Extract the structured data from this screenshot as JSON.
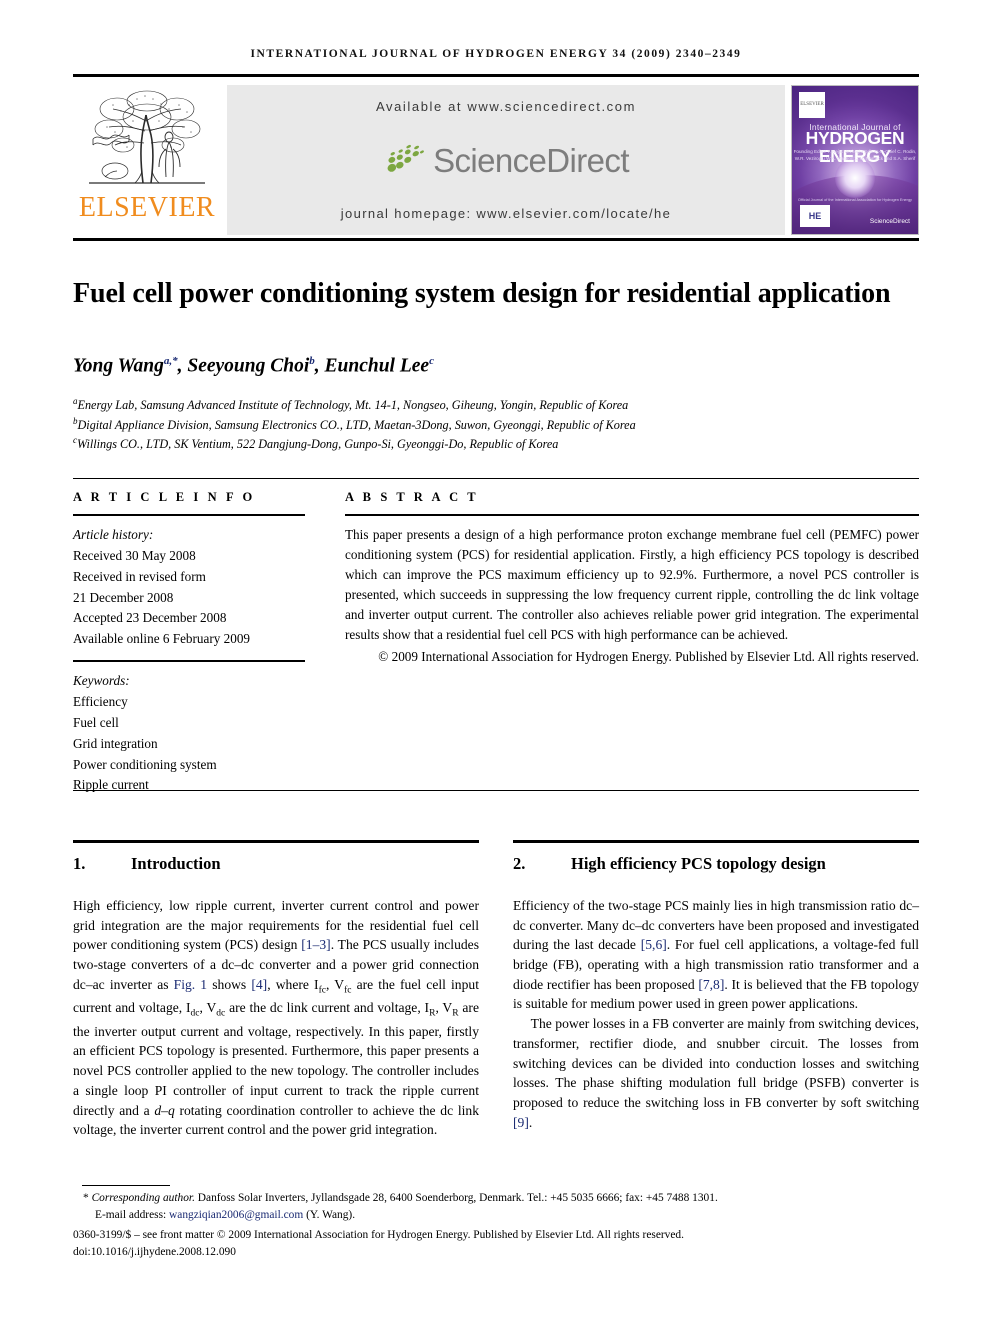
{
  "running_head": "INTERNATIONAL JOURNAL OF HYDROGEN ENERGY 34 (2009) 2340–2349",
  "header": {
    "publisher_name": "ELSEVIER",
    "publisher_logo_icon": "elsevier-tree-icon",
    "available_at": "Available at www.sciencedirect.com",
    "sciencedirect_logo_text": "ScienceDirect",
    "sciencedirect_logo_icon": "sciencedirect-leaves-icon",
    "journal_homepage": "journal homepage: www.elsevier.com/locate/he",
    "cover": {
      "elsevier_mark": "ELSEVIER",
      "line1": "International Journal of",
      "line2": "HYDROGEN",
      "line3": "ENERGY",
      "editors": "Founding Editor  T. Nejat Veziroglu\nEditors-in-Chief  C. Rodin, W.R. Veziroglu\nW.A. Manson, J.M. Norbeck\nand S.A. Sherif",
      "badge": "HE",
      "sciencedirect_mark": "ScienceDirect",
      "footnote": "Official Journal of the International Association for Hydrogen Energy"
    }
  },
  "article": {
    "title": "Fuel cell power conditioning system design for residential application",
    "authors": [
      {
        "name": "Yong Wang",
        "sup": "a,*"
      },
      {
        "name": "Seeyoung Choi",
        "sup": "b"
      },
      {
        "name": "Eunchul Lee",
        "sup": "c"
      }
    ],
    "authors_line": "Yong Wang, Seeyoung Choi, Eunchul Lee",
    "affiliations": [
      {
        "mark": "a",
        "text": "Energy Lab, Samsung Advanced Institute of Technology, Mt. 14-1, Nongseo, Giheung, Yongin, Republic of Korea"
      },
      {
        "mark": "b",
        "text": "Digital Appliance Division, Samsung Electronics CO., LTD, Maetan-3Dong, Suwon, Gyeonggi, Republic of Korea"
      },
      {
        "mark": "c",
        "text": "Willings CO., LTD, SK Ventium, 522 Dangjung-Dong, Gunpo-Si, Gyeonggi-Do, Republic of Korea"
      }
    ]
  },
  "article_info": {
    "heading": "A R T I C L E   I N F O",
    "history_label": "Article history:",
    "history": [
      "Received 30 May 2008",
      "Received in revised form",
      "21 December 2008",
      "Accepted 23 December 2008",
      "Available online 6 February 2009"
    ],
    "keywords_label": "Keywords:",
    "keywords": [
      "Efficiency",
      "Fuel cell",
      "Grid integration",
      "Power conditioning system",
      "Ripple current"
    ]
  },
  "abstract": {
    "heading": "A B S T R A C T",
    "body": "This paper presents a design of a high performance proton exchange membrane fuel cell (PEMFC) power conditioning system (PCS) for residential application. Firstly, a high efficiency PCS topology is described which can improve the PCS maximum efficiency up to 92.9%. Furthermore, a novel PCS controller is presented, which succeeds in suppressing the low frequency current ripple, controlling the dc link voltage and inverter output current. The controller also achieves reliable power grid integration. The experimental results show that a residential fuel cell PCS with high performance can be achieved.",
    "copyright": "© 2009 International Association for Hydrogen Energy. Published by Elsevier Ltd. All rights reserved."
  },
  "sections": {
    "left": {
      "number": "1.",
      "title": "Introduction",
      "paragraph1_parts": {
        "p1": "High efficiency, low ripple current, inverter current control and power grid integration are the major requirements for the residential fuel cell power conditioning system (PCS) design ",
        "ref1": "[1–3]",
        "p2": ". The PCS usually includes two-stage converters of a dc–dc converter and a power grid connection dc–ac inverter as ",
        "ref2": "Fig. 1",
        "p3": " shows ",
        "ref3": "[4]",
        "p4": ", where I",
        "sub1": "fc",
        "p5": ", V",
        "sub2": "fc",
        "p6": " are the fuel cell input current and voltage, I",
        "sub3": "dc",
        "p7": ", V",
        "sub4": "dc",
        "p8": " are the dc link current and voltage, I",
        "sub5": "R",
        "p9": ", V",
        "sub6": "R",
        "p10": " are the inverter output current and voltage, respectively. In this paper, firstly an efficient PCS topology is presented. Furthermore, this paper presents a novel PCS controller applied to the new topology. The controller includes a single loop PI controller of input current to track the ripple current directly and a ",
        "ital1": "d–q",
        "p11": " rotating coordination controller to achieve the dc link voltage, the inverter current control and the power grid integration."
      }
    },
    "right": {
      "number": "2.",
      "title": "High efficiency PCS topology design",
      "paragraph1_parts": {
        "p1": "Efficiency of the two-stage PCS mainly lies in high transmission ratio dc–dc converter. Many dc–dc converters have been proposed and investigated during the last decade ",
        "ref1": "[5,6]",
        "p2": ". For fuel cell applications, a voltage-fed full bridge (FB), operating with a high transmission ratio transformer and a diode rectifier has been proposed ",
        "ref2": "[7,8]",
        "p3": ". It is believed that the FB topology is suitable for medium power used in green power applications."
      },
      "paragraph2_parts": {
        "p1": "The power losses in a FB converter are mainly from switching devices, transformer, rectifier diode, and snubber circuit. The losses from switching devices can be divided into conduction losses and switching losses. The phase shifting modulation full bridge (PSFB) converter is proposed to reduce the switching loss in FB converter by soft switching ",
        "ref1": "[9]",
        "p2": "."
      }
    }
  },
  "footer": {
    "corresponding_marker": "*",
    "corresponding_label": "Corresponding author.",
    "corresponding_text": " Danfoss Solar Inverters, Jyllandsgade 28, 6400 Soenderborg, Denmark. Tel.: +45 5035 6666; fax: +45 7488 1301.",
    "email_label": "E-mail address:",
    "email": "wangziqian2006@gmail.com",
    "email_suffix": "(Y. Wang).",
    "issn_line": "0360-3199/$ – see front matter © 2009 International Association for Hydrogen Energy. Published by Elsevier Ltd. All rights reserved.",
    "doi_line": "doi:10.1016/j.ijhydene.2008.12.090"
  },
  "colors": {
    "elsevier_orange": "#F08C1E",
    "sciencedirect_green": "#7DA742",
    "sciencedirect_gray": "#7d7d7d",
    "link_blue": "#1a2a72",
    "band_gray": "#e9e9e9"
  }
}
